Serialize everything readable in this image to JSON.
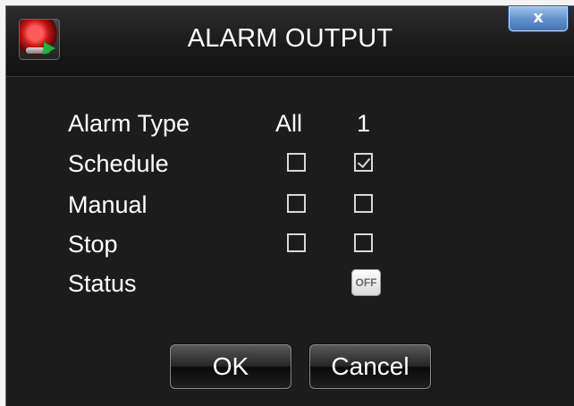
{
  "window": {
    "title": "ALARM OUTPUT",
    "close_label": "x"
  },
  "table": {
    "headers": [
      "Alarm Type",
      "All",
      "1"
    ],
    "rows": [
      {
        "label": "Schedule",
        "all_checked": false,
        "channel_1_checked": true
      },
      {
        "label": "Manual",
        "all_checked": false,
        "channel_1_checked": false
      },
      {
        "label": "Stop",
        "all_checked": false,
        "channel_1_checked": false
      },
      {
        "label": "Status",
        "status_value": "OFF"
      }
    ]
  },
  "buttons": {
    "ok_label": "OK",
    "cancel_label": "Cancel"
  },
  "colors": {
    "background": "#1c1c1c",
    "close_button": "#5d8ec9",
    "text": "#ffffff"
  },
  "icons": {
    "app": "alarm-output-icon",
    "close": "close-icon"
  }
}
